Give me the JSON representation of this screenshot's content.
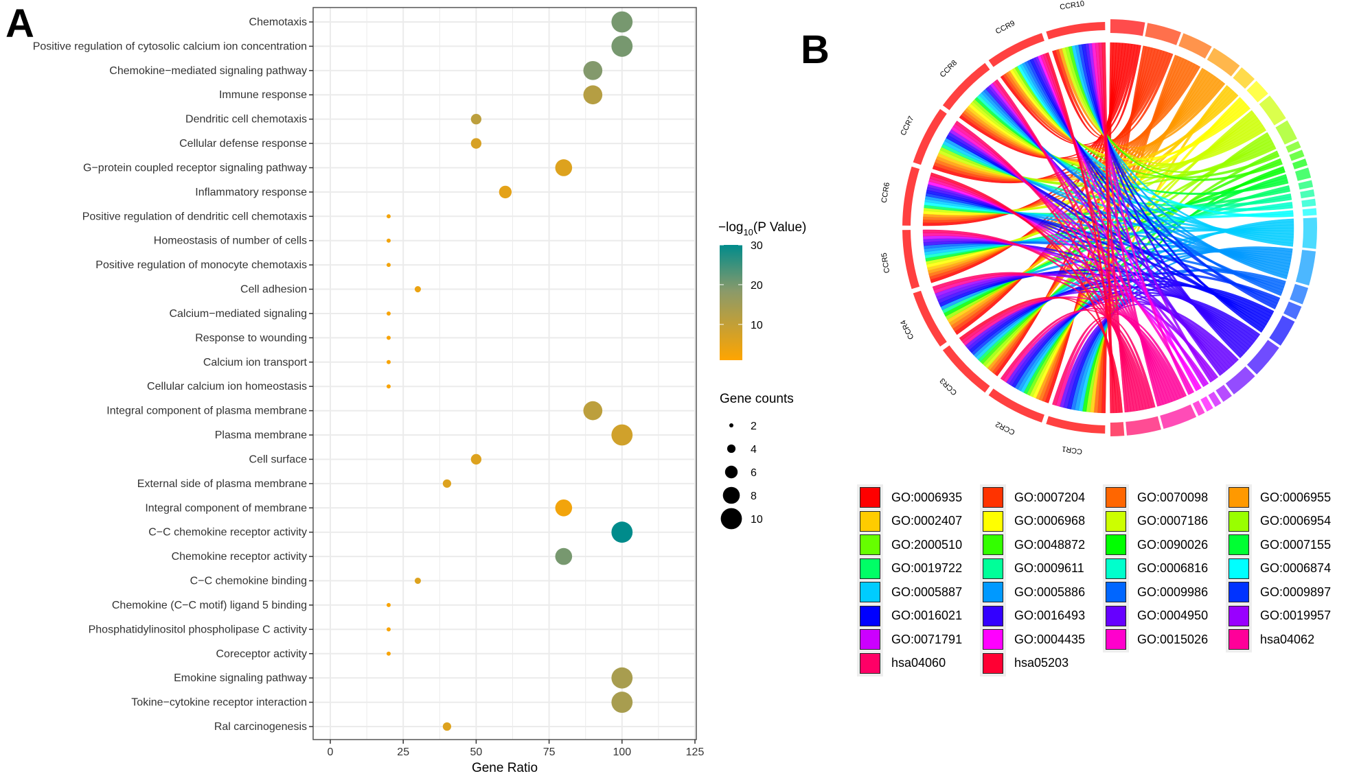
{
  "panels": {
    "a_label": "A",
    "b_label": "B"
  },
  "chart_data": [
    {
      "type": "scatter",
      "subtype": "bubble",
      "panel": "A",
      "xlabel": "Gene Ratio",
      "ylabel": "",
      "xlim": [
        -5,
        125
      ],
      "xticks": [
        0,
        25,
        50,
        75,
        100,
        125
      ],
      "grid": true,
      "color_legend": {
        "title_prefix": "−log",
        "title_sub": "10",
        "title_suffix": "(P Value)",
        "ticks": [
          10,
          20,
          30
        ],
        "range": [
          1,
          30
        ],
        "low_color": "#FFA500",
        "mid_color": "#8A9A6A",
        "high_color": "#008B8B"
      },
      "size_legend": {
        "title": "Gene counts",
        "values": [
          2,
          4,
          6,
          8,
          10
        ]
      },
      "terms": [
        {
          "label": "Chemotaxis",
          "ratio": 100,
          "count": 10,
          "neglog10p": 20
        },
        {
          "label": "Positive regulation of cytosolic calcium ion concentration",
          "ratio": 100,
          "count": 10,
          "neglog10p": 20
        },
        {
          "label": "Chemokine−mediated signaling pathway",
          "ratio": 90,
          "count": 9,
          "neglog10p": 19
        },
        {
          "label": "Immune response",
          "ratio": 90,
          "count": 9,
          "neglog10p": 12
        },
        {
          "label": "Dendritic cell chemotaxis",
          "ratio": 50,
          "count": 5,
          "neglog10p": 11
        },
        {
          "label": "Cellular defense response",
          "ratio": 50,
          "count": 5,
          "neglog10p": 7
        },
        {
          "label": "G−protein coupled receptor signaling pathway",
          "ratio": 80,
          "count": 8,
          "neglog10p": 6
        },
        {
          "label": "Inflammatory response",
          "ratio": 60,
          "count": 6,
          "neglog10p": 5
        },
        {
          "label": "Positive regulation of dendritic cell chemotaxis",
          "ratio": 20,
          "count": 2,
          "neglog10p": 3
        },
        {
          "label": "Homeostasis of number of cells",
          "ratio": 20,
          "count": 2,
          "neglog10p": 3
        },
        {
          "label": "Positive regulation of monocyte chemotaxis",
          "ratio": 20,
          "count": 2,
          "neglog10p": 3
        },
        {
          "label": "Cell adhesion",
          "ratio": 30,
          "count": 3,
          "neglog10p": 4
        },
        {
          "label": "Calcium−mediated signaling",
          "ratio": 20,
          "count": 2,
          "neglog10p": 2
        },
        {
          "label": "Response to wounding",
          "ratio": 20,
          "count": 2,
          "neglog10p": 2
        },
        {
          "label": "Calcium ion transport",
          "ratio": 20,
          "count": 2,
          "neglog10p": 2
        },
        {
          "label": "Cellular calcium ion homeostasis",
          "ratio": 20,
          "count": 2,
          "neglog10p": 2
        },
        {
          "label": "Integral component of plasma membrane",
          "ratio": 90,
          "count": 9,
          "neglog10p": 11
        },
        {
          "label": "Plasma membrane",
          "ratio": 100,
          "count": 10,
          "neglog10p": 8
        },
        {
          "label": "Cell surface",
          "ratio": 50,
          "count": 5,
          "neglog10p": 6
        },
        {
          "label": "External side of plasma membrane",
          "ratio": 40,
          "count": 4,
          "neglog10p": 6
        },
        {
          "label": "Integral component of membrane",
          "ratio": 80,
          "count": 8,
          "neglog10p": 3
        },
        {
          "label": "C−C chemokine receptor activity",
          "ratio": 100,
          "count": 10,
          "neglog10p": 30
        },
        {
          "label": "Chemokine receptor activity",
          "ratio": 80,
          "count": 8,
          "neglog10p": 20
        },
        {
          "label": "C−C chemokine binding",
          "ratio": 30,
          "count": 3,
          "neglog10p": 6
        },
        {
          "label": "Chemokine (C−C motif) ligand 5 binding",
          "ratio": 20,
          "count": 2,
          "neglog10p": 2
        },
        {
          "label": "Phosphatidylinositol phospholipase C activity",
          "ratio": 20,
          "count": 2,
          "neglog10p": 2
        },
        {
          "label": "Coreceptor activity",
          "ratio": 20,
          "count": 2,
          "neglog10p": 2
        },
        {
          "label": "Emokine signaling pathway",
          "ratio": 100,
          "count": 10,
          "neglog10p": 14
        },
        {
          "label": "Tokine−cytokine receptor interaction",
          "ratio": 100,
          "count": 10,
          "neglog10p": 14
        },
        {
          "label": "Ral carcinogenesis",
          "ratio": 40,
          "count": 4,
          "neglog10p": 6
        }
      ]
    },
    {
      "type": "chord",
      "panel": "B",
      "genes": [
        "CCR1",
        "CCR2",
        "CCR3",
        "CCR4",
        "CCR5",
        "CCR6",
        "CCR7",
        "CCR8",
        "CCR9",
        "CCR10"
      ],
      "gene_color": "#FF4040",
      "terms": [
        {
          "id": "GO:0006935",
          "color": "#FF0000",
          "weight": 10
        },
        {
          "id": "GO:0007204",
          "color": "#FF3300",
          "weight": 10
        },
        {
          "id": "GO:0070098",
          "color": "#FF6600",
          "weight": 9
        },
        {
          "id": "GO:0006955",
          "color": "#FF9900",
          "weight": 9
        },
        {
          "id": "GO:0002407",
          "color": "#FFCC00",
          "weight": 5
        },
        {
          "id": "GO:0006968",
          "color": "#FFFF00",
          "weight": 5
        },
        {
          "id": "GO:0007186",
          "color": "#CCFF00",
          "weight": 8
        },
        {
          "id": "GO:0006954",
          "color": "#99FF00",
          "weight": 6
        },
        {
          "id": "GO:2000510",
          "color": "#66FF00",
          "weight": 2
        },
        {
          "id": "GO:0048872",
          "color": "#33FF00",
          "weight": 2
        },
        {
          "id": "GO:0090026",
          "color": "#00FF00",
          "weight": 2
        },
        {
          "id": "GO:0007155",
          "color": "#00FF33",
          "weight": 3
        },
        {
          "id": "GO:0019722",
          "color": "#00FF66",
          "weight": 2
        },
        {
          "id": "GO:0009611",
          "color": "#00FF99",
          "weight": 2
        },
        {
          "id": "GO:0006816",
          "color": "#00FFCC",
          "weight": 2
        },
        {
          "id": "GO:0006874",
          "color": "#00FFFF",
          "weight": 2
        },
        {
          "id": "GO:0005887",
          "color": "#00CCFF",
          "weight": 9
        },
        {
          "id": "GO:0005886",
          "color": "#0099FF",
          "weight": 10
        },
        {
          "id": "GO:0009986",
          "color": "#0066FF",
          "weight": 5
        },
        {
          "id": "GO:0009897",
          "color": "#0033FF",
          "weight": 4
        },
        {
          "id": "GO:0016021",
          "color": "#0000FF",
          "weight": 8
        },
        {
          "id": "GO:0016493",
          "color": "#3300FF",
          "weight": 10
        },
        {
          "id": "GO:0004950",
          "color": "#6600FF",
          "weight": 8
        },
        {
          "id": "GO:0019957",
          "color": "#9900FF",
          "weight": 3
        },
        {
          "id": "GO:0071791",
          "color": "#CC00FF",
          "weight": 2
        },
        {
          "id": "GO:0004435",
          "color": "#FF00FF",
          "weight": 2
        },
        {
          "id": "GO:0015026",
          "color": "#FF00CC",
          "weight": 2
        },
        {
          "id": "hsa04062",
          "color": "#FF0099",
          "weight": 10
        },
        {
          "id": "hsa04060",
          "color": "#FF0066",
          "weight": 10
        },
        {
          "id": "hsa05203",
          "color": "#FF0033",
          "weight": 4
        }
      ]
    }
  ]
}
